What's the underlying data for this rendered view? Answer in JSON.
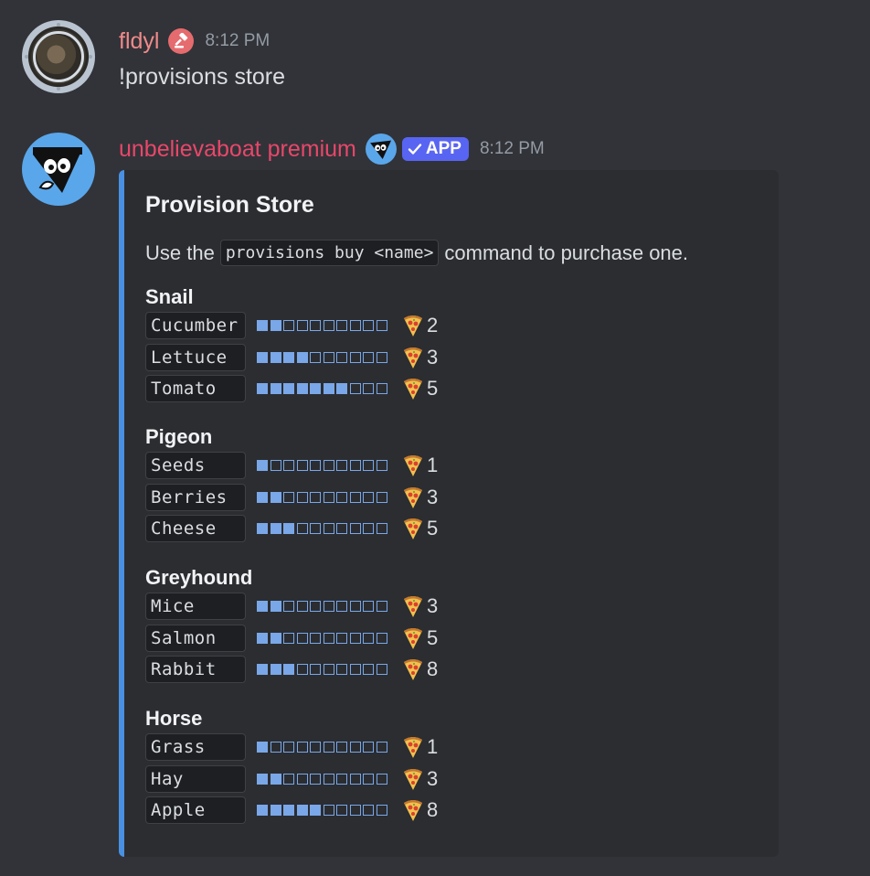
{
  "messages": [
    {
      "username": "fldyl",
      "username_color": "#f08a8a",
      "role_icon": "gavel-icon",
      "time": "8:12 PM",
      "text": "!provisions store"
    },
    {
      "username": "unbelievaboat premium",
      "username_color": "#e8476a",
      "app_tag": "APP",
      "time": "8:12 PM"
    }
  ],
  "embed": {
    "accent_color": "#4a90e2",
    "title": "Provision Store",
    "desc_before": "Use the",
    "desc_code": "provisions buy <name>",
    "desc_after": "command to purchase one.",
    "sections": [
      {
        "name": "Snail",
        "items": [
          {
            "name": "Cucumber",
            "level": 2,
            "cost": "2"
          },
          {
            "name": "Lettuce",
            "level": 4,
            "cost": "3"
          },
          {
            "name": "Tomato",
            "level": 7,
            "cost": "5"
          }
        ]
      },
      {
        "name": "Pigeon",
        "items": [
          {
            "name": "Seeds",
            "level": 1,
            "cost": "1"
          },
          {
            "name": "Berries",
            "level": 2,
            "cost": "3"
          },
          {
            "name": "Cheese",
            "level": 3,
            "cost": "5"
          }
        ]
      },
      {
        "name": "Greyhound",
        "items": [
          {
            "name": "Mice",
            "level": 2,
            "cost": "3"
          },
          {
            "name": "Salmon",
            "level": 2,
            "cost": "5"
          },
          {
            "name": "Rabbit",
            "level": 3,
            "cost": "8"
          }
        ]
      },
      {
        "name": "Horse",
        "items": [
          {
            "name": "Grass",
            "level": 1,
            "cost": "1"
          },
          {
            "name": "Hay",
            "level": 2,
            "cost": "3"
          },
          {
            "name": "Apple",
            "level": 5,
            "cost": "8"
          }
        ]
      }
    ],
    "bar_total": 10,
    "bar_color": "#7aa7e8",
    "currency_icon": "pizza-icon"
  }
}
